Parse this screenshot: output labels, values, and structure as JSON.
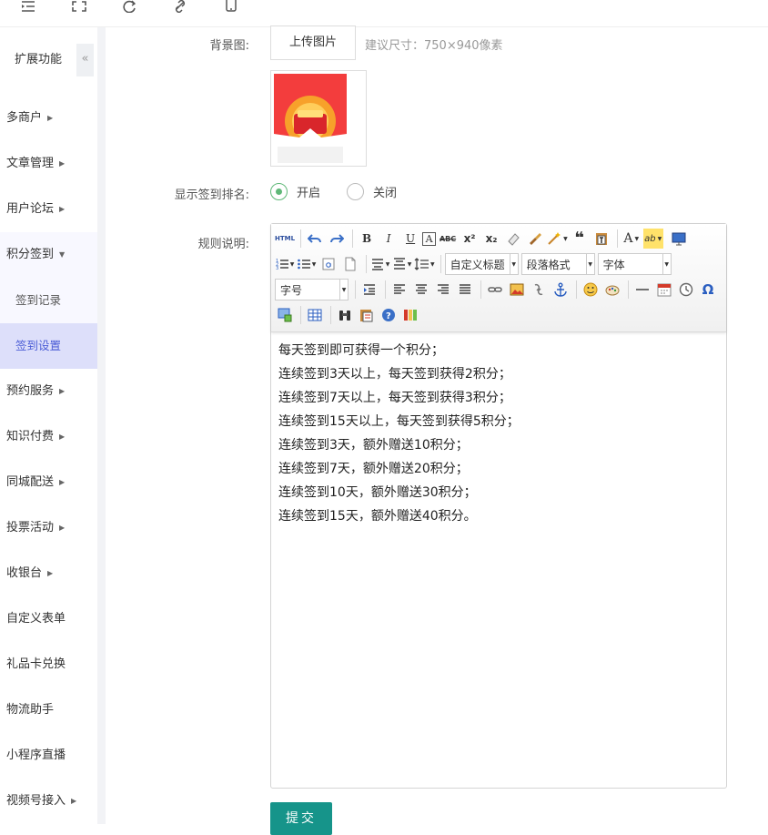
{
  "topbar": {
    "icons": [
      "menu-icon",
      "fullscreen-icon",
      "refresh-icon",
      "link-icon",
      "mobile-icon"
    ]
  },
  "sidebar": {
    "title": "扩展功能",
    "collapse_glyph": "«",
    "items": [
      {
        "label": "多商户",
        "arrow": "▶"
      },
      {
        "label": "文章管理",
        "arrow": "▶"
      },
      {
        "label": "用户论坛",
        "arrow": "▶"
      },
      {
        "label": "积分签到",
        "arrow": "▼"
      },
      {
        "label": "签到记录"
      },
      {
        "label": "签到设置"
      },
      {
        "label": "预约服务",
        "arrow": "▶"
      },
      {
        "label": "知识付费",
        "arrow": "▶"
      },
      {
        "label": "同城配送",
        "arrow": "▶"
      },
      {
        "label": "投票活动",
        "arrow": "▶"
      },
      {
        "label": "收银台",
        "arrow": "▶"
      },
      {
        "label": "自定义表单"
      },
      {
        "label": "礼品卡兑换"
      },
      {
        "label": "物流助手"
      },
      {
        "label": "小程序直播"
      },
      {
        "label": "视频号接入",
        "arrow": "▶"
      }
    ]
  },
  "form": {
    "bg_label": "背景图:",
    "upload_label": "上传图片",
    "size_hint": "建议尺寸：750×940像素",
    "rank_label": "显示签到排名:",
    "radio_on": "开启",
    "radio_off": "关闭",
    "rules_label": "规则说明:",
    "submit_label": "提交"
  },
  "editor": {
    "html_label": "HTML",
    "bold": "B",
    "italic": "I",
    "underline": "U",
    "font_color": "A",
    "strike": "ABC",
    "sup": "x²",
    "sub": "x₂",
    "quote": "❝",
    "text_color": "A",
    "bg_color": "ab",
    "omega": "Ω",
    "select_custom_title": "自定义标题",
    "select_paragraph": "段落格式",
    "select_font": "字体",
    "select_size": "字号",
    "dropdown_glyph": "▼",
    "content_lines": [
      "每天签到即可获得一个积分；",
      "连续签到3天以上，每天签到获得2积分；",
      "连续签到7天以上，每天签到获得3积分；",
      "连续签到15天以上，每天签到获得5积分；",
      "连续签到3天，额外赠送10积分；",
      "连续签到7天，额外赠送20积分；",
      "连续签到10天，额外赠送30积分；",
      "连续签到15天，额外赠送40积分。"
    ]
  },
  "colors": {
    "accent_green": "#16948a",
    "radio_green": "#5fb878",
    "active_nav_bg": "#dddffa"
  }
}
